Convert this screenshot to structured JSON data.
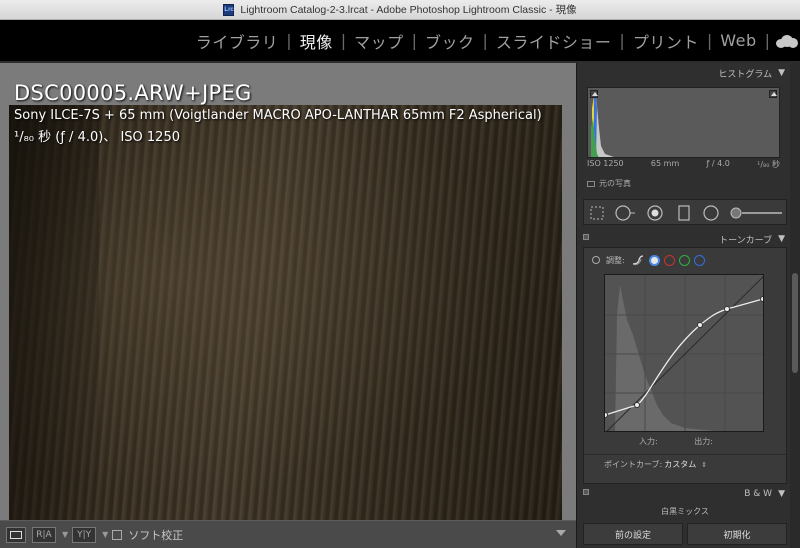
{
  "window": {
    "title": "Lightroom Catalog-2-3.lrcat - Adobe Photoshop Lightroom Classic - 現像",
    "icon_name": "lightroom-catalog-icon"
  },
  "modules": [
    {
      "label": "ライブラリ",
      "active": false
    },
    {
      "label": "現像",
      "active": true
    },
    {
      "label": "マップ",
      "active": false
    },
    {
      "label": "ブック",
      "active": false
    },
    {
      "label": "スライドショー",
      "active": false
    },
    {
      "label": "プリント",
      "active": false
    },
    {
      "label": "Web",
      "active": false
    }
  ],
  "module_separator": "|",
  "viewer": {
    "filename": "DSC00005.ARW+JPEG",
    "camera_info": "Sony ILCE-7S + 65 mm (Voigtlander MACRO APO-LANTHAR 65mm F2 Aspherical)",
    "exposure_info": "¹/₈₀ 秒 (ƒ / 4.0)、 ISO 1250"
  },
  "toolbar": {
    "ab_label": "R|A",
    "yy_label": "Y|Y",
    "softproof_label": "ソフト校正",
    "softproof_checked": false
  },
  "histogram": {
    "title": "ヒストグラム",
    "iso": "ISO 1250",
    "focal": "65 mm",
    "aperture": "ƒ / 4.0",
    "shutter": "¹/₈₀ 秒",
    "original_photo_label": "元の写真"
  },
  "tone_curve": {
    "title": "トーンカーブ",
    "adjust_label": "調整:",
    "input_label": "入力:",
    "output_label": "出力:",
    "point_curve_label": "ポイントカーブ:",
    "point_curve_value": "カスタム",
    "updown_icon": "⇕",
    "channels": [
      {
        "name": "rgb",
        "color": "#ffffff"
      },
      {
        "name": "red",
        "color": "#d03030"
      },
      {
        "name": "green",
        "color": "#30b040"
      },
      {
        "name": "blue",
        "color": "#3070e0"
      }
    ]
  },
  "bw": {
    "title": "B & W",
    "content_label": "白黒ミックス"
  },
  "buttons": {
    "previous": "前の設定",
    "reset": "初期化"
  },
  "colors": {
    "panel_bg": "#2f2f2f",
    "viewer_bg": "#7b7b7b",
    "accent_blue": "#3070e0"
  }
}
